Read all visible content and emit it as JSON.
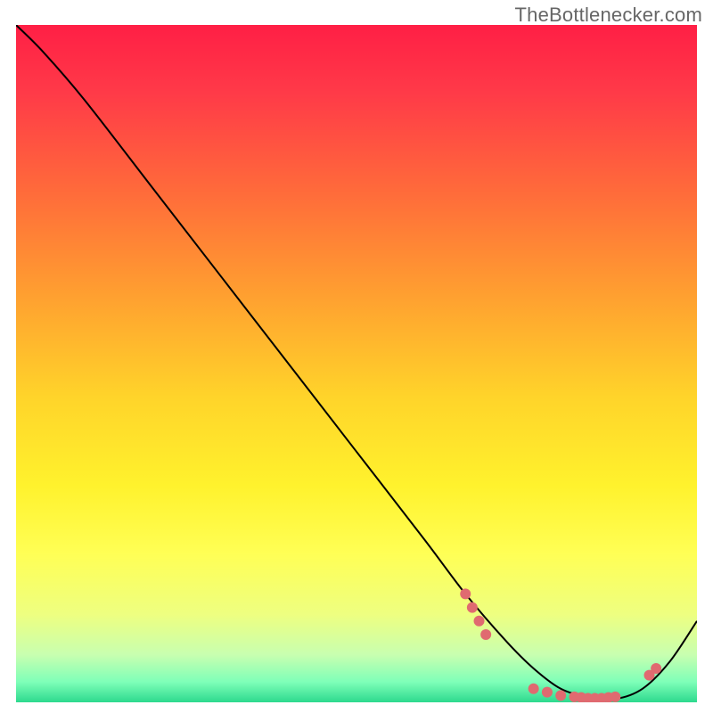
{
  "watermark": "TheBottlenecker.com",
  "chart_data": {
    "type": "line",
    "title": "",
    "xlabel": "",
    "ylabel": "",
    "xlim": [
      0,
      100
    ],
    "ylim": [
      0,
      100
    ],
    "grid": false,
    "background": {
      "type": "vertical-gradient",
      "stops": [
        {
          "offset": 0.0,
          "color": "#ff1f45"
        },
        {
          "offset": 0.1,
          "color": "#ff3a48"
        },
        {
          "offset": 0.25,
          "color": "#ff6c3a"
        },
        {
          "offset": 0.4,
          "color": "#ffa030"
        },
        {
          "offset": 0.55,
          "color": "#ffd42a"
        },
        {
          "offset": 0.68,
          "color": "#fff22d"
        },
        {
          "offset": 0.78,
          "color": "#ffff55"
        },
        {
          "offset": 0.87,
          "color": "#eeff80"
        },
        {
          "offset": 0.93,
          "color": "#c8ffb0"
        },
        {
          "offset": 0.97,
          "color": "#7effb8"
        },
        {
          "offset": 1.0,
          "color": "#2dd98e"
        }
      ]
    },
    "series": [
      {
        "name": "curve",
        "color": "#000000",
        "width": 2,
        "x": [
          0,
          4,
          10,
          20,
          30,
          40,
          50,
          60,
          66,
          72,
          76,
          80,
          84,
          88,
          92,
          96,
          100
        ],
        "y": [
          100,
          96,
          89,
          76,
          63,
          50,
          37,
          24,
          16,
          9,
          5,
          2,
          0.8,
          0.5,
          2,
          6,
          12
        ]
      }
    ],
    "markers": {
      "color": "#e06a70",
      "radius": 6,
      "points": [
        {
          "x": 66,
          "y": 16
        },
        {
          "x": 67,
          "y": 14
        },
        {
          "x": 68,
          "y": 12
        },
        {
          "x": 69,
          "y": 10
        },
        {
          "x": 76,
          "y": 2.0
        },
        {
          "x": 78,
          "y": 1.5
        },
        {
          "x": 80,
          "y": 1.0
        },
        {
          "x": 82,
          "y": 0.8
        },
        {
          "x": 83,
          "y": 0.7
        },
        {
          "x": 84,
          "y": 0.6
        },
        {
          "x": 85,
          "y": 0.6
        },
        {
          "x": 86,
          "y": 0.6
        },
        {
          "x": 87,
          "y": 0.7
        },
        {
          "x": 88,
          "y": 0.8
        },
        {
          "x": 93,
          "y": 4.0
        },
        {
          "x": 94,
          "y": 5.0
        }
      ]
    }
  }
}
